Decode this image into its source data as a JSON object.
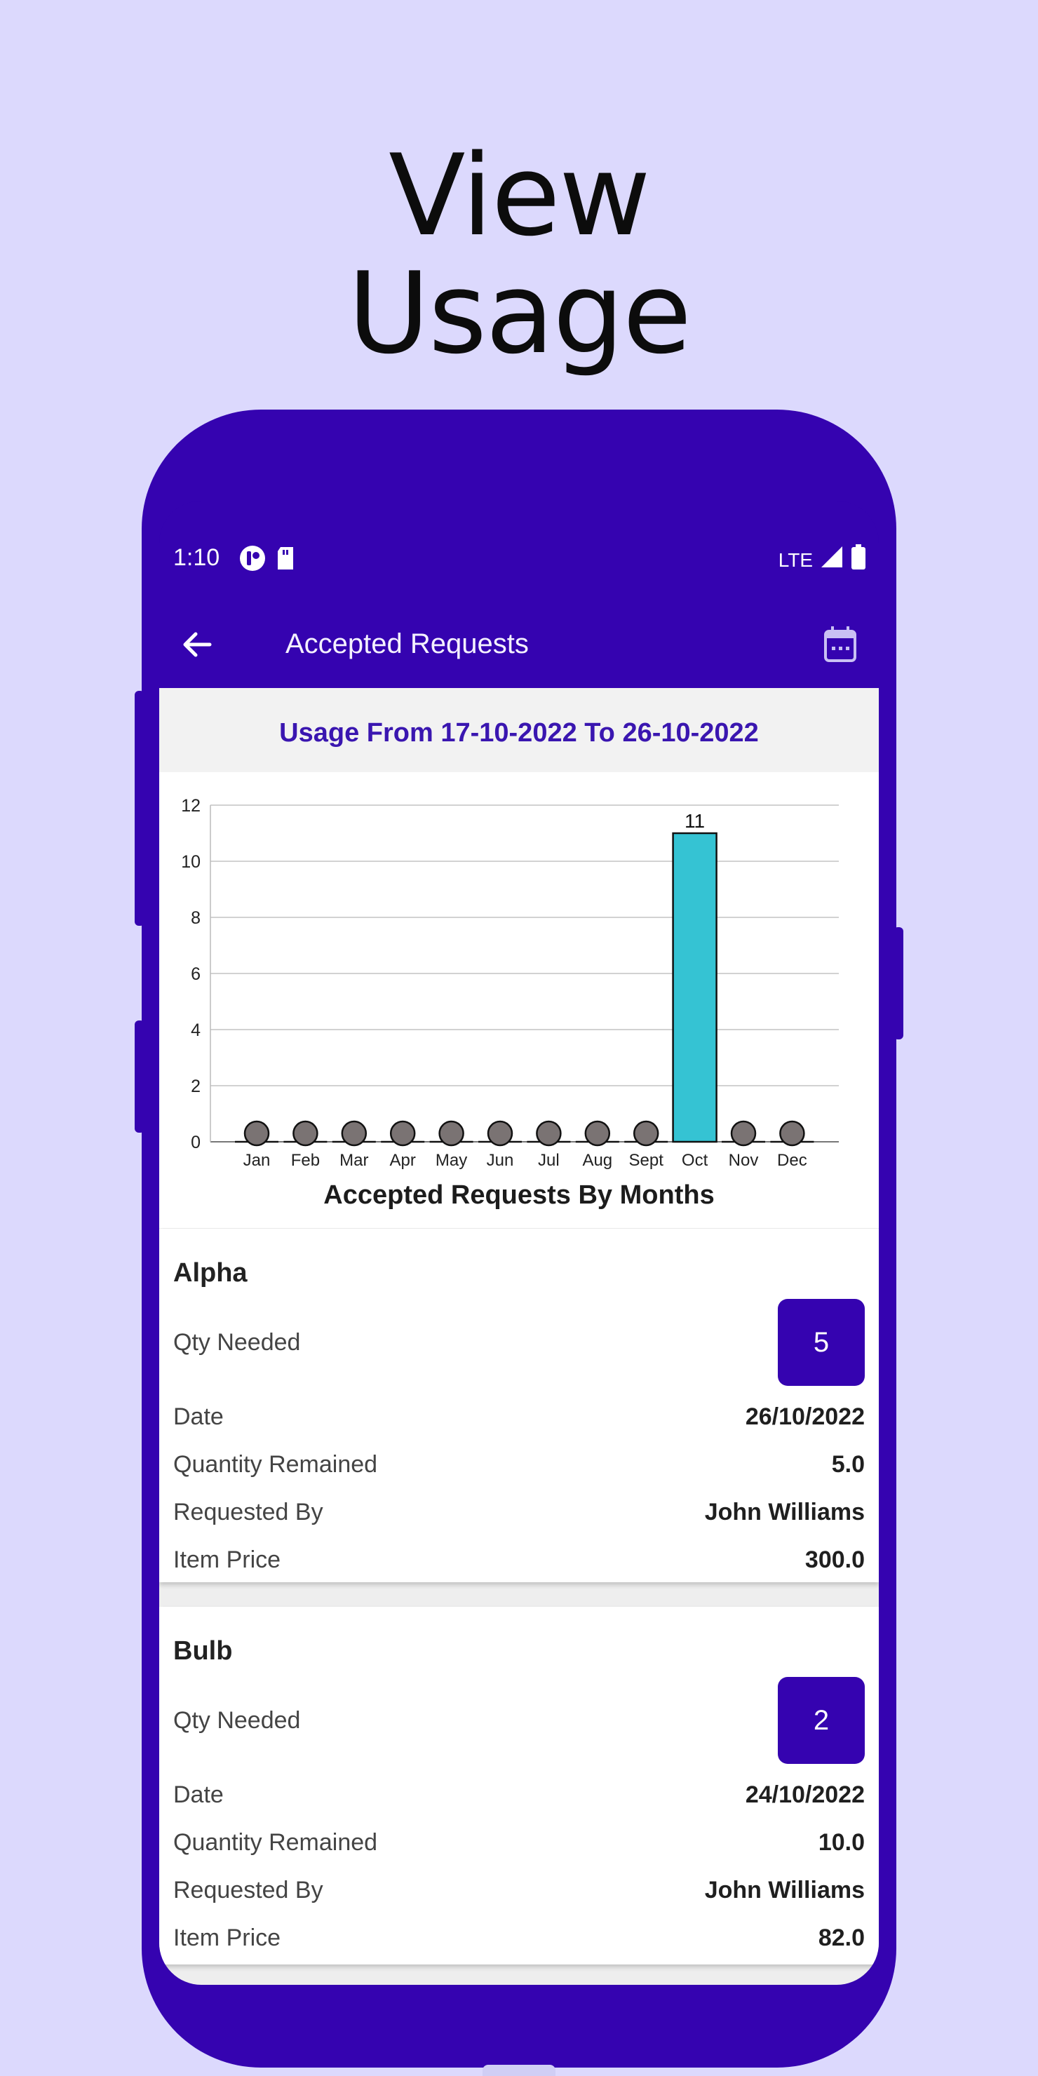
{
  "hero": {
    "line1": "View",
    "line2": "Usage"
  },
  "status_bar": {
    "time": "1:10",
    "network": "LTE"
  },
  "app_bar": {
    "title": "Accepted Requests"
  },
  "range_header": "Usage From 17-10-2022 To 26-10-2022",
  "colors": {
    "accent": "#3503b0",
    "bar": "#35c3d3",
    "marker": "#7a7373",
    "background": "#dcd9fd"
  },
  "icons": {
    "back": "arrow-left-icon",
    "calendar": "calendar-icon"
  },
  "chart_data": {
    "type": "bar",
    "title": "Accepted Requests By Months",
    "categories": [
      "Jan",
      "Feb",
      "Mar",
      "Apr",
      "May",
      "Jun",
      "Jul",
      "Aug",
      "Sept",
      "Oct",
      "Nov",
      "Dec"
    ],
    "values": [
      0,
      0,
      0,
      0,
      0,
      0,
      0,
      0,
      0,
      11,
      0,
      0
    ],
    "ylim": [
      0,
      12
    ],
    "yticks": [
      0,
      2,
      4,
      6,
      8,
      10,
      12
    ],
    "grid": true,
    "data_labels": {
      "Oct": "11"
    }
  },
  "requests": [
    {
      "name": "Alpha",
      "qty_label": "Qty Needed",
      "qty": "5",
      "rows": [
        {
          "label": "Date",
          "value": "26/10/2022"
        },
        {
          "label": "Quantity Remained",
          "value": "5.0"
        },
        {
          "label": "Requested By",
          "value": "John Williams"
        },
        {
          "label": "Item Price",
          "value": "300.0"
        }
      ]
    },
    {
      "name": "Bulb",
      "qty_label": "Qty Needed",
      "qty": "2",
      "rows": [
        {
          "label": "Date",
          "value": "24/10/2022"
        },
        {
          "label": "Quantity Remained",
          "value": "10.0"
        },
        {
          "label": "Requested By",
          "value": "John Williams"
        },
        {
          "label": "Item Price",
          "value": "82.0"
        }
      ]
    }
  ]
}
